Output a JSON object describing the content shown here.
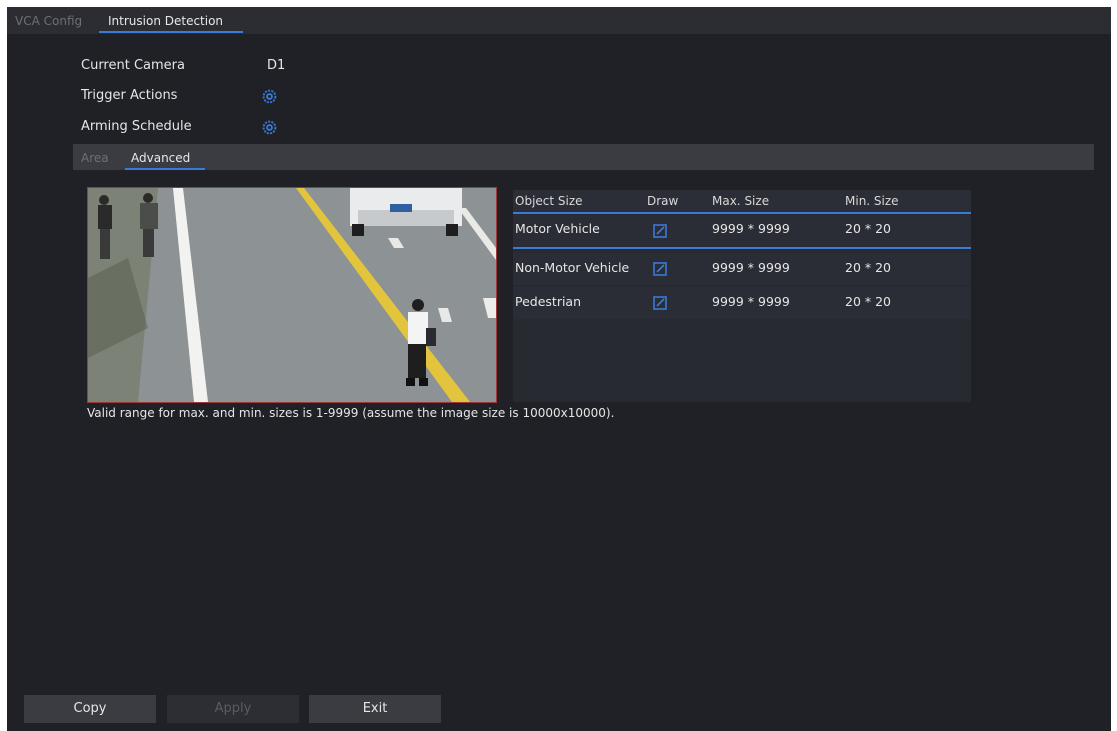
{
  "tabs": {
    "vca_config": "VCA Config",
    "intrusion_detection": "Intrusion Detection"
  },
  "fields": {
    "current_camera_label": "Current Camera",
    "current_camera_value": "D1",
    "trigger_actions_label": "Trigger Actions",
    "arming_schedule_label": "Arming Schedule"
  },
  "subtabs": {
    "area": "Area",
    "advanced": "Advanced"
  },
  "table": {
    "headers": [
      "Object Size",
      "Draw",
      "Max. Size",
      "Min. Size"
    ],
    "rows": [
      {
        "name": "Motor Vehicle",
        "max": "9999 * 9999",
        "min": "20 * 20"
      },
      {
        "name": "Non-Motor Vehicle",
        "max": "9999 * 9999",
        "min": "20 * 20"
      },
      {
        "name": "Pedestrian",
        "max": "9999 * 9999",
        "min": "20 * 20"
      }
    ]
  },
  "note": "Valid range for max. and min. sizes is 1-9999 (assume the image size is 10000x10000).",
  "buttons": {
    "copy": "Copy",
    "apply": "Apply",
    "exit": "Exit"
  },
  "icons": {
    "trigger_actions": "gear-icon",
    "arming_schedule": "gear-icon",
    "draw": "edit-icon"
  },
  "colors": {
    "accent": "#3a7ad8",
    "background": "#1f2126",
    "preview_border": "#9c3a3a"
  }
}
